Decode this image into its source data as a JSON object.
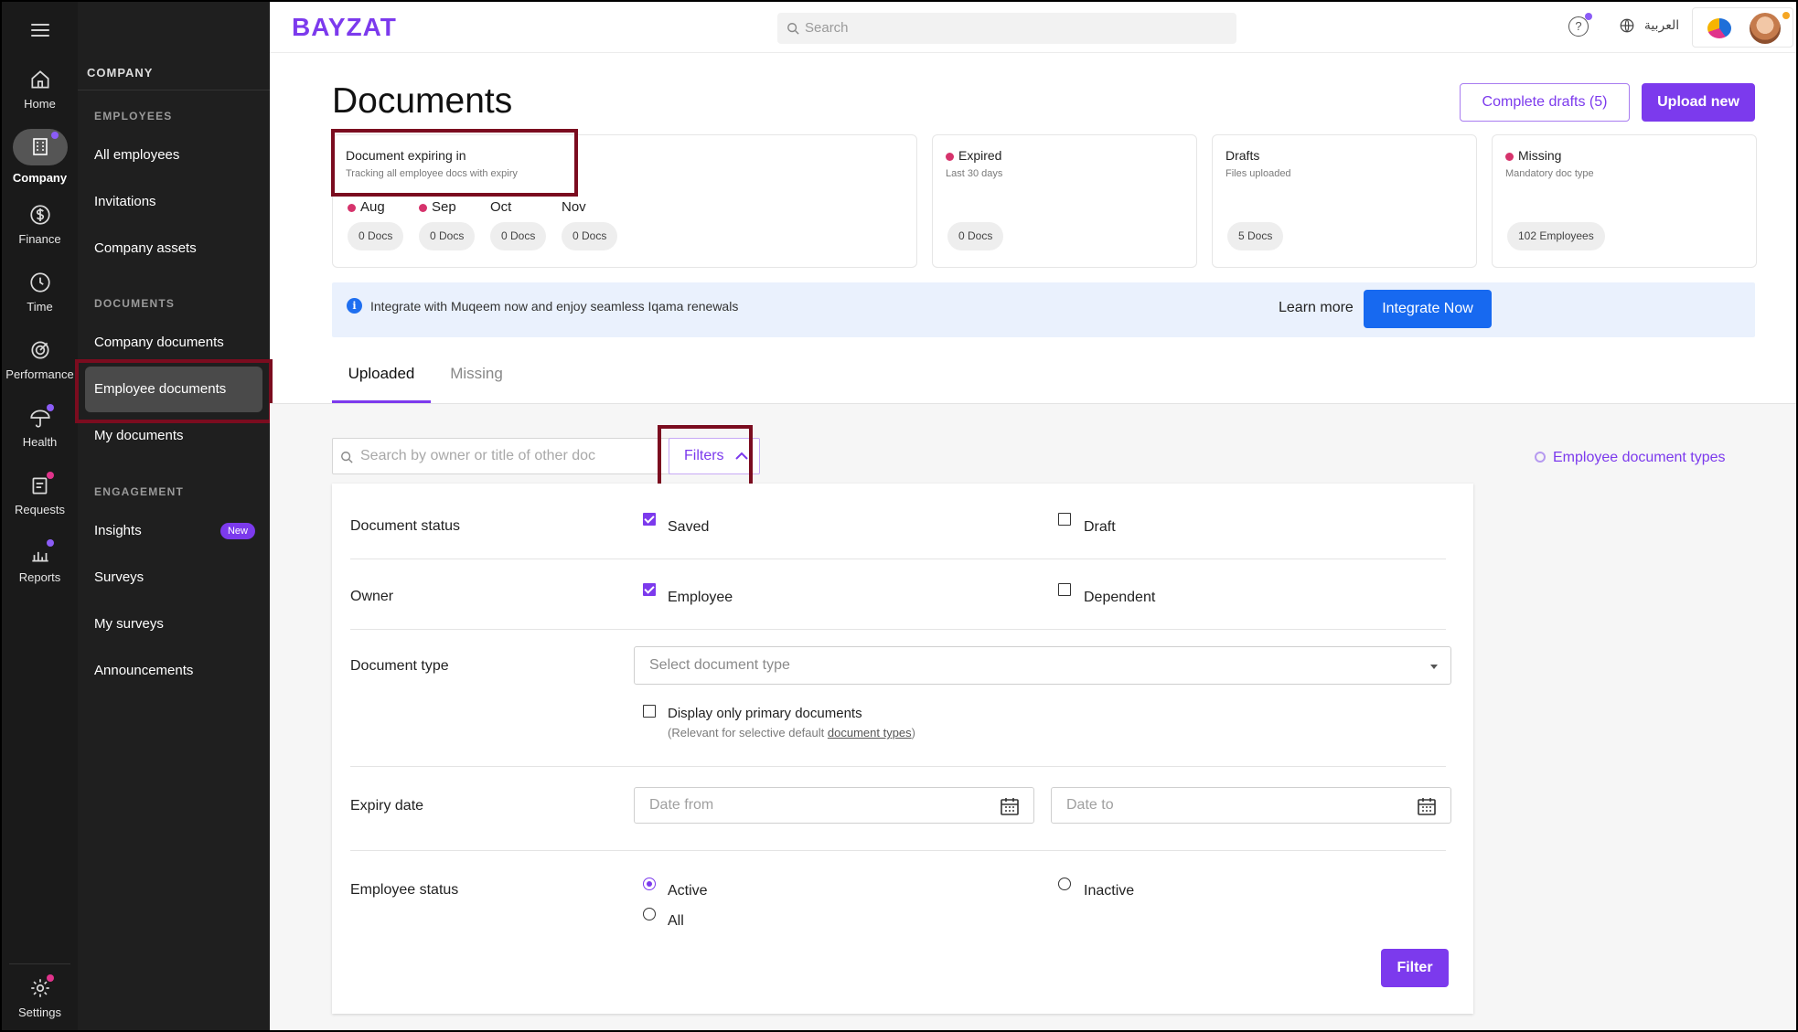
{
  "brand": {
    "logo": "BAYZAT",
    "accent": "#7c3aed",
    "annotation_color": "#7b0c1f"
  },
  "topbar": {
    "search_placeholder": "Search",
    "language": "العربية",
    "icons": [
      "menu-icon",
      "search-icon",
      "help-icon",
      "globe-icon"
    ]
  },
  "rail": {
    "items": [
      {
        "label": "Home",
        "icon": "home-icon"
      },
      {
        "label": "Company",
        "icon": "building-icon",
        "active": true
      },
      {
        "label": "Finance",
        "icon": "dollar-icon"
      },
      {
        "label": "Time",
        "icon": "clock-icon"
      },
      {
        "label": "Performance",
        "icon": "target-icon"
      },
      {
        "label": "Health",
        "icon": "umbrella-icon"
      },
      {
        "label": "Requests",
        "icon": "clipboard-icon"
      },
      {
        "label": "Reports",
        "icon": "chart-icon"
      },
      {
        "label": "Settings",
        "icon": "gear-icon"
      }
    ]
  },
  "panel": {
    "title": "COMPANY",
    "sections": {
      "employees": "EMPLOYEES",
      "documents": "DOCUMENTS",
      "engagement": "ENGAGEMENT"
    },
    "items": {
      "all_employees": "All employees",
      "invitations": "Invitations",
      "company_assets": "Company assets",
      "company_documents": "Company documents",
      "employee_documents": "Employee documents",
      "my_documents": "My documents",
      "insights": "Insights",
      "insights_badge": "New",
      "surveys": "Surveys",
      "my_surveys": "My surveys",
      "announcements": "Announcements"
    }
  },
  "page": {
    "title": "Documents",
    "complete_drafts": "Complete drafts (5)",
    "upload_new": "Upload new"
  },
  "cards": {
    "expiring": {
      "title": "Document expiring in",
      "subtitle": "Tracking all employee docs with expiry",
      "months": [
        {
          "label": "Aug",
          "count": "0 Docs",
          "flag": true
        },
        {
          "label": "Sep",
          "count": "0 Docs",
          "flag": true
        },
        {
          "label": "Oct",
          "count": "0 Docs",
          "flag": false
        },
        {
          "label": "Nov",
          "count": "0 Docs",
          "flag": false
        }
      ]
    },
    "expired": {
      "title": "Expired",
      "subtitle": "Last 30 days",
      "value": "0 Docs"
    },
    "drafts": {
      "title": "Drafts",
      "subtitle": "Files uploaded",
      "value": "5 Docs"
    },
    "missing": {
      "title": "Missing",
      "subtitle": "Mandatory doc type",
      "value": "102 Employees"
    }
  },
  "banner": {
    "text": "Integrate with Muqeem now and enjoy seamless Iqama renewals",
    "learn_more": "Learn more",
    "integrate": "Integrate Now"
  },
  "tabs": {
    "uploaded": "Uploaded",
    "missing": "Missing"
  },
  "toolbar": {
    "search_placeholder": "Search by owner or title of other doc",
    "filters": "Filters",
    "types_link": "Employee document types"
  },
  "filters": {
    "status": {
      "label": "Document status",
      "saved": "Saved",
      "draft": "Draft"
    },
    "owner": {
      "label": "Owner",
      "employee": "Employee",
      "dependent": "Dependent"
    },
    "type": {
      "label": "Document type",
      "placeholder": "Select document type",
      "primary_only": "Display only primary documents",
      "hint_prefix": "(Relevant for selective default ",
      "hint_link": "document types",
      "hint_suffix": ")"
    },
    "expiry": {
      "label": "Expiry date",
      "from": "Date from",
      "to": "Date to"
    },
    "emp_status": {
      "label": "Employee status",
      "active": "Active",
      "inactive": "Inactive",
      "all": "All"
    },
    "submit": "Filter"
  }
}
